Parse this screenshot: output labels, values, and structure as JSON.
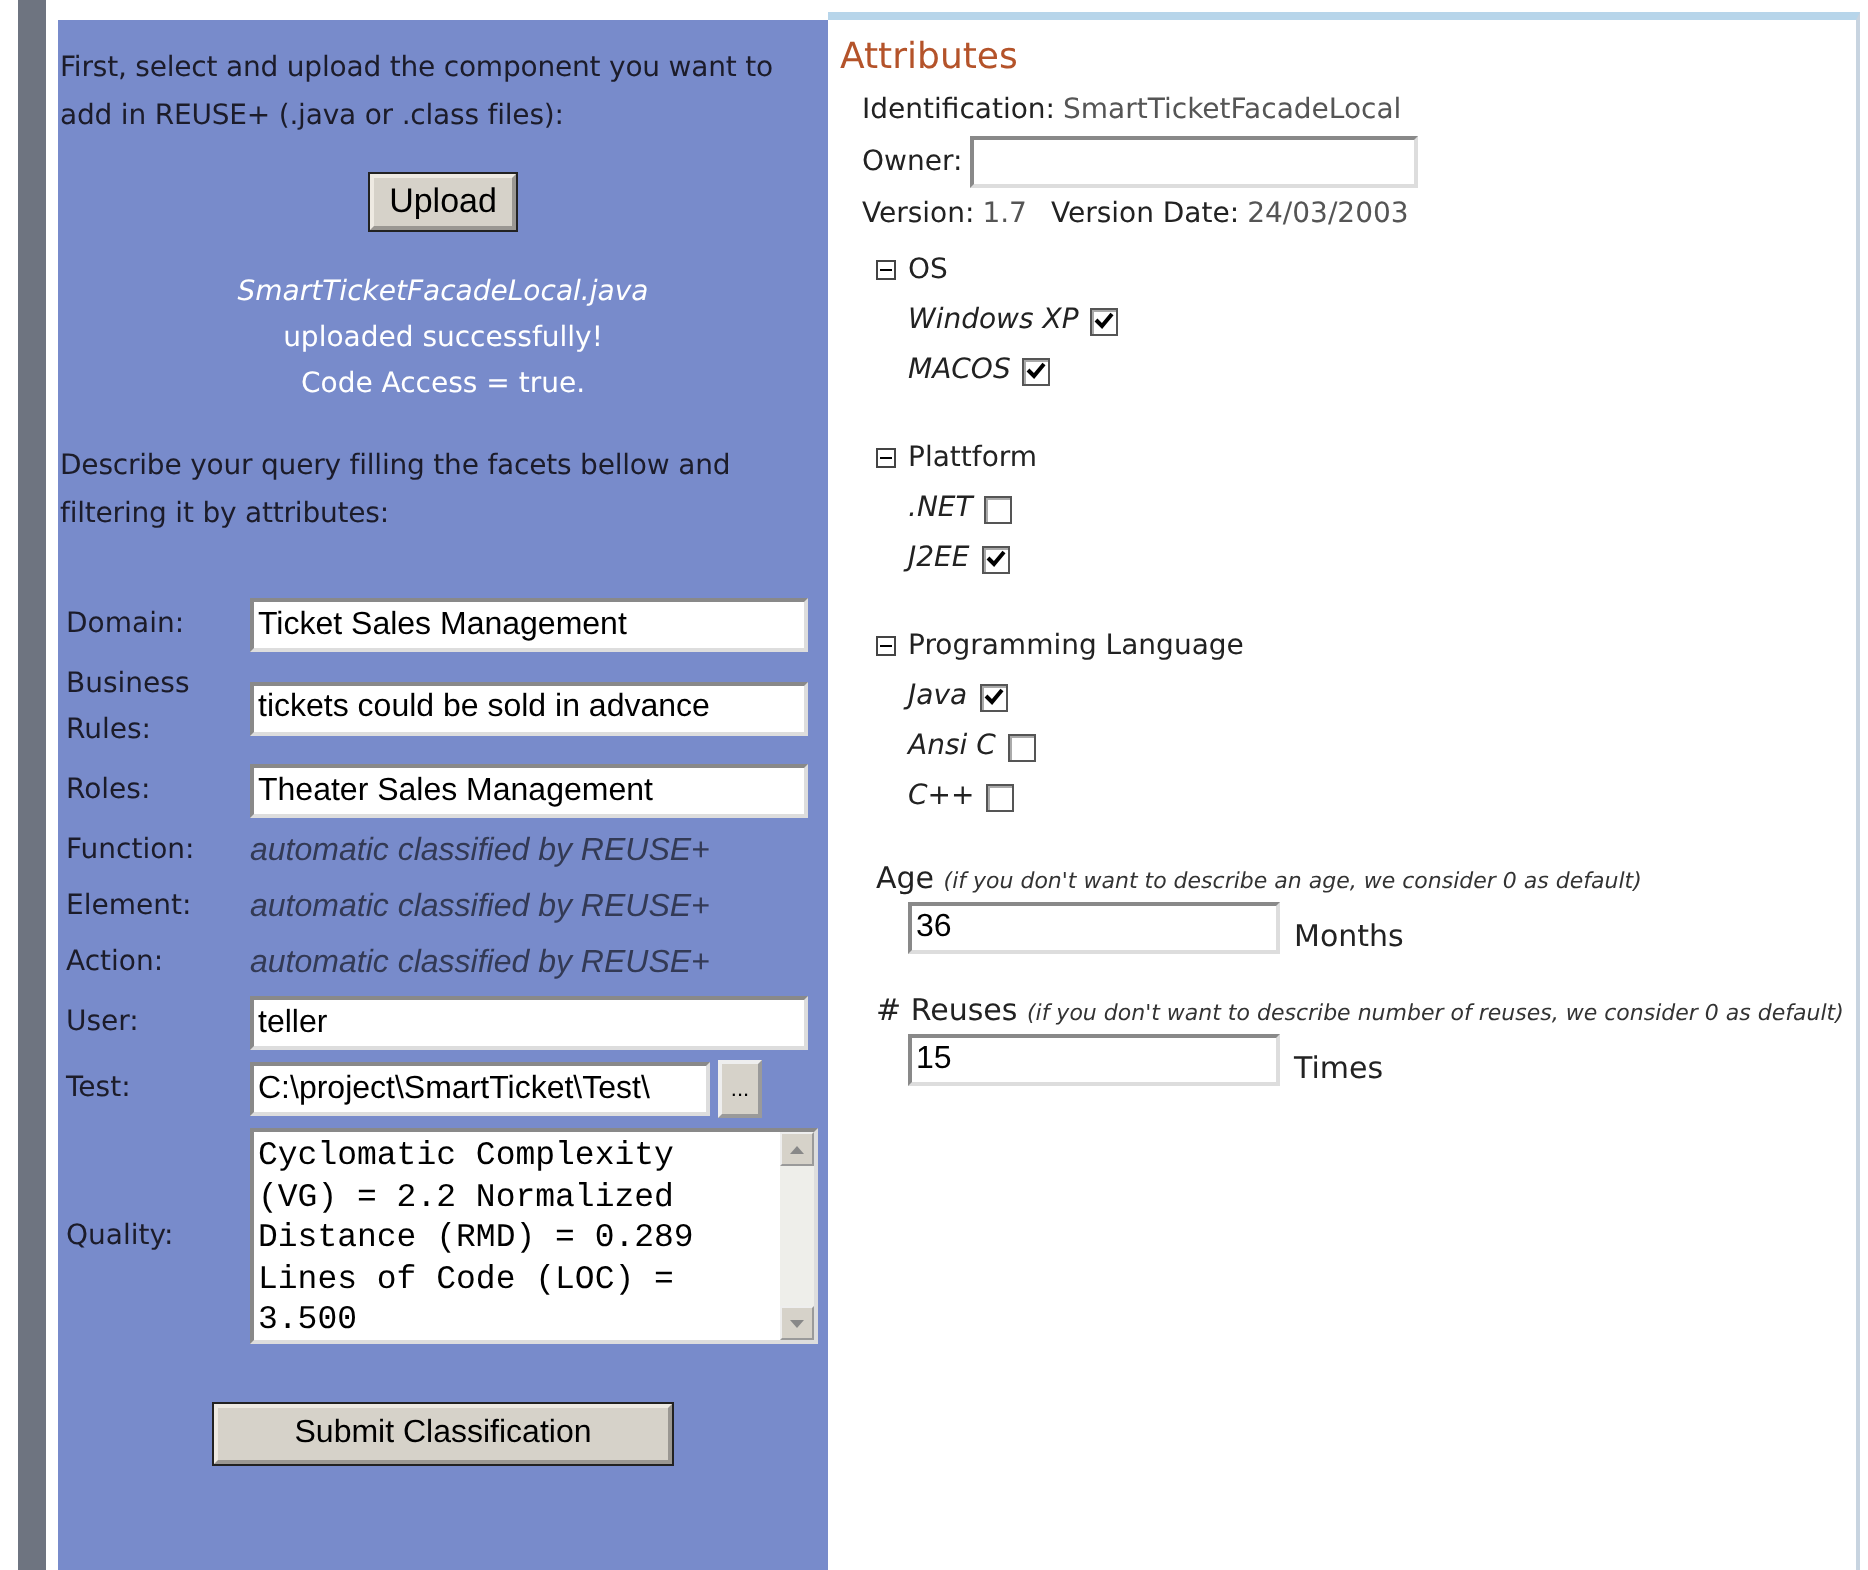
{
  "upload": {
    "intro": "First, select and upload the component you want to add in REUSE+ (.java or .class files):",
    "button": "Upload",
    "file_name": "SmartTicketFacadeLocal.java",
    "status_lines": [
      "uploaded successfully!",
      "Code Access = true."
    ],
    "query_intro": "Describe your query filling the facets bellow and filtering it by attributes:"
  },
  "facets": [
    {
      "kind": "input",
      "label": "Domain:",
      "value": "Ticket Sales Management"
    },
    {
      "kind": "input",
      "label": "Business Rules:",
      "value": "tickets could be sold in advance"
    },
    {
      "kind": "input",
      "label": "Roles:",
      "value": "Theater Sales Management"
    },
    {
      "kind": "auto",
      "label": "Function:",
      "value": "automatic classified by REUSE+"
    },
    {
      "kind": "auto",
      "label": "Element:",
      "value": "automatic classified by REUSE+"
    },
    {
      "kind": "auto",
      "label": "Action:",
      "value": "automatic classified by REUSE+"
    },
    {
      "kind": "input",
      "label": "User:",
      "value": "teller"
    },
    {
      "kind": "browse",
      "label": "Test:",
      "value": "C:\\project\\SmartTicket\\Test\\",
      "button": "..."
    },
    {
      "kind": "textarea",
      "label": "Quality:",
      "value": "Cyclomatic Complexity (VG) = 2.2 Normalized Distance (RMD) = 0.289 Lines of Code (LOC) = 3.500"
    }
  ],
  "submit": "Submit Classification",
  "attributes": {
    "title": "Attributes",
    "identification": {
      "label": "Identification:",
      "value": "SmartTicketFacadeLocal"
    },
    "owner": {
      "label": "Owner:"
    },
    "version": {
      "label": "Version:",
      "value": "1.7"
    },
    "version_date": {
      "label": "Version Date:",
      "value": "24/03/2003"
    },
    "groups": [
      {
        "name": "OS",
        "expanded": true,
        "options": [
          {
            "label": "Windows XP",
            "checked": true
          },
          {
            "label": "MACOS",
            "checked": true
          }
        ]
      },
      {
        "name": "Plattform",
        "expanded": true,
        "options": [
          {
            "label": ".NET",
            "checked": false
          },
          {
            "label": "J2EE",
            "checked": true
          }
        ]
      },
      {
        "name": "Programming Language",
        "expanded": true,
        "options": [
          {
            "label": "Java",
            "checked": true
          },
          {
            "label": "Ansi C",
            "checked": false
          },
          {
            "label": "C++",
            "checked": false
          }
        ]
      }
    ],
    "age": {
      "label": "Age",
      "hint": "(if you don't want to describe an age, we consider 0 as default)",
      "value": "36",
      "unit": "Months"
    },
    "reuses": {
      "label": "# Reuses",
      "hint": "(if you don't want to describe number of reuses, we consider 0 as default)",
      "value": "15",
      "unit": "Times"
    }
  }
}
